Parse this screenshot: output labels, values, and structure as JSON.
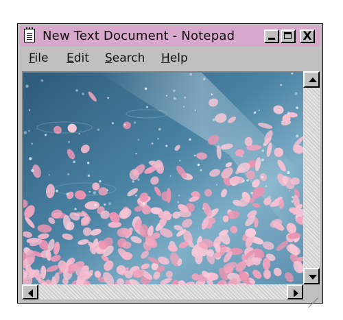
{
  "window": {
    "title": "New Text Document - Notepad",
    "title_bar_color": "#d8a8cc"
  },
  "title_buttons": {
    "minimize_icon": "minimize-icon",
    "maximize_icon": "maximize-icon",
    "close_glyph": "X"
  },
  "menu": {
    "items": [
      {
        "label_u": "F",
        "label_rest": "ile"
      },
      {
        "label_u": "E",
        "label_rest": "dit"
      },
      {
        "label_u": "S",
        "label_rest": "earch"
      },
      {
        "label_u": "H",
        "label_rest": "elp"
      }
    ]
  },
  "content": {
    "image": "cherry-blossom-petals-on-water",
    "colors": {
      "water": "#3e6f8f",
      "petal": "#f2b3c9"
    }
  },
  "scrollbars": {
    "vertical_up_icon": "arrow-up-icon",
    "vertical_down_icon": "arrow-down-icon",
    "horizontal_left_icon": "arrow-left-icon",
    "horizontal_right_icon": "arrow-right-icon",
    "resize_icon": "resize-grip-icon"
  }
}
